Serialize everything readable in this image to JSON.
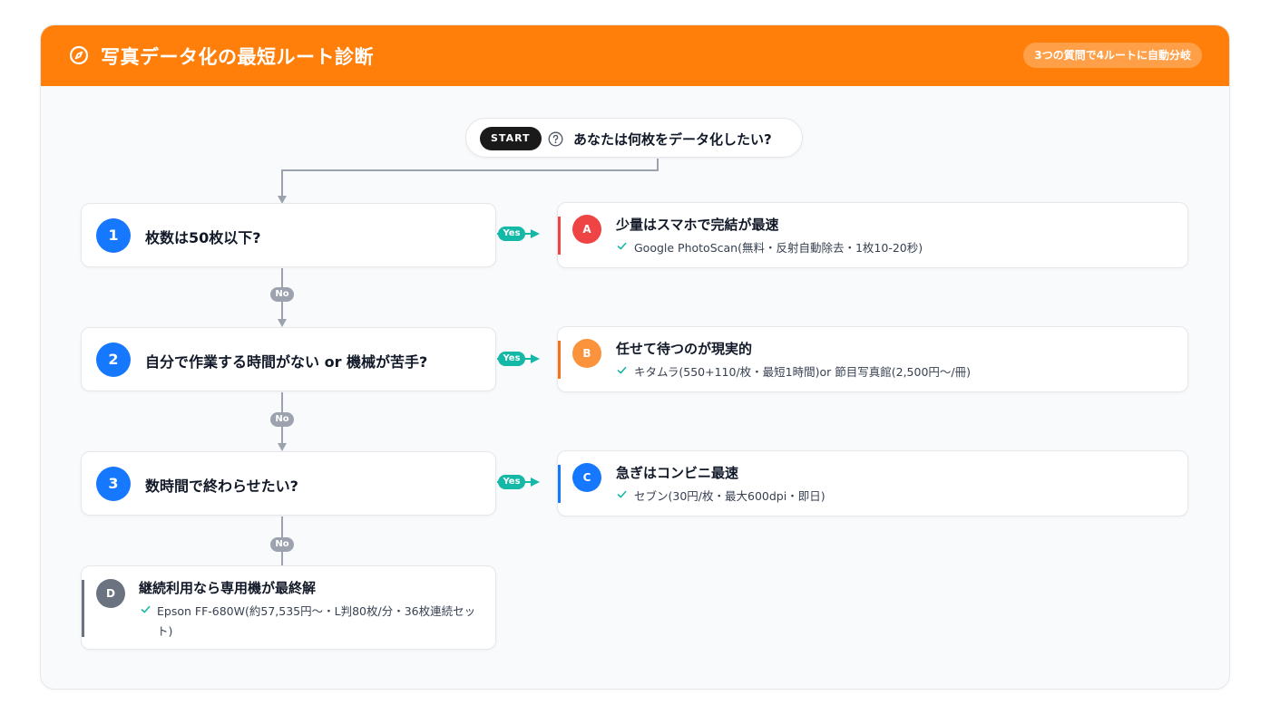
{
  "header": {
    "title": "写真データ化の最短ルート診断",
    "pill": "3つの質問で4ルートに自動分岐",
    "icon": "compass-icon"
  },
  "start": {
    "badge": "START",
    "question": "あなたは何枚をデータ化したい?",
    "icon": "help-circle-icon"
  },
  "questions": [
    {
      "num": "1",
      "label": "枚数は50枚以下?"
    },
    {
      "num": "2",
      "label": "自分で作業する時間がない or 機械が苦手?"
    },
    {
      "num": "3",
      "label": "数時間で終わらせたい?"
    }
  ],
  "edges": {
    "yes": "Yes",
    "no": "No"
  },
  "answers": [
    {
      "letter": "A",
      "title": "少量はスマホで完結が最速",
      "desc": "Google PhotoScan(無料・反射自動除去・1枚10-20秒)",
      "color": "#ef4444"
    },
    {
      "letter": "B",
      "title": "任せて待つのが現実的",
      "desc": "キタムラ(550+110/枚・最短1時間)or 節目写真館(2,500円〜/冊)",
      "color": "#f97316"
    },
    {
      "letter": "C",
      "title": "急ぎはコンビニ最速",
      "desc": "セブン(30円/枚・最大600dpi・即日)",
      "color": "#1677ff"
    },
    {
      "letter": "D",
      "title": "継続利用なら専用機が最終解",
      "desc": "Epson FF-680W(約57,535円〜・L判80枚/分・36枚連続セット)",
      "color": "#6b7280"
    }
  ],
  "colors": {
    "accent": "#ff7f0a",
    "question_num": "#1677ff",
    "yes": "#14b8a6",
    "no": "#9ca3af"
  }
}
